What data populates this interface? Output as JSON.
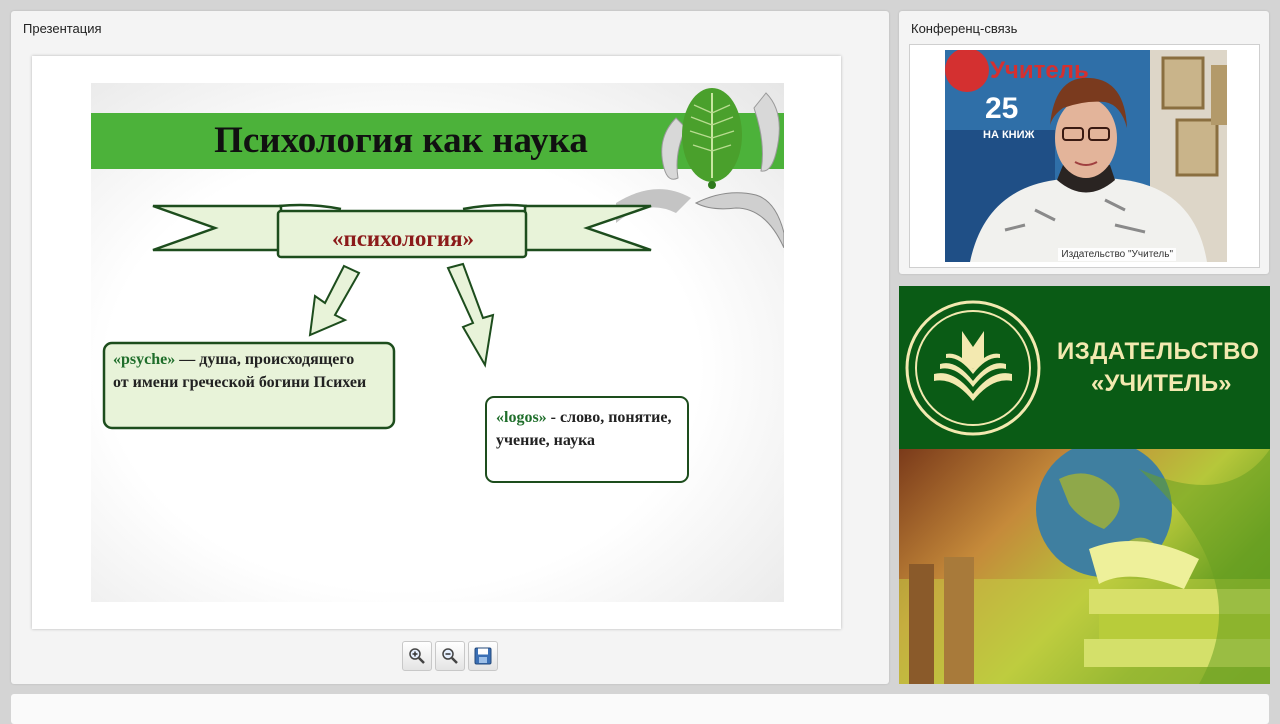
{
  "presentation": {
    "panel_title": "Презентация",
    "slide": {
      "title": "Психология как наука",
      "ribbon_word": "«психология»",
      "definitions": [
        {
          "term": "«psyche»",
          "text": " — душа, происходящего от имени греческой богини Психеи"
        },
        {
          "term": "«logos»",
          "text": " - слово, понятие, учение, наука"
        }
      ],
      "colors": {
        "band": "#4cb23a",
        "ribbon_fill": "#e8f3d9",
        "ribbon_border": "#1d4d1d",
        "word": "#8b1a1a"
      }
    },
    "toolbar": [
      {
        "name": "zoom-in",
        "icon": "zoom-in-icon"
      },
      {
        "name": "zoom-out",
        "icon": "zoom-out-icon"
      },
      {
        "name": "save",
        "icon": "floppy-disk-icon"
      }
    ]
  },
  "conference": {
    "panel_title": "Конференц-связь",
    "video_label": "Издательство \"Учитель\""
  },
  "publisher_ad": {
    "name_line1": "ИЗДАТЕЛЬСТВО",
    "name_line2": "«УЧИТЕЛЬ»",
    "colors": {
      "background": "#0a5b15",
      "text": "#f3e9b0"
    }
  }
}
